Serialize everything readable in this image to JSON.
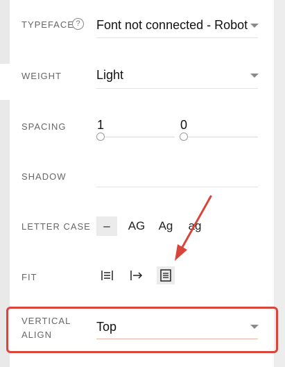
{
  "typeface": {
    "label": "TYPEFACE",
    "help_glyph": "?",
    "value": "Font not connected - Roboto"
  },
  "weight": {
    "label": "WEIGHT",
    "value": "Light"
  },
  "spacing": {
    "label": "SPACING",
    "letter_value": "1",
    "line_value": "0"
  },
  "shadow": {
    "label": "SHADOW"
  },
  "letter_case": {
    "label": "LETTER CASE",
    "options": [
      "–",
      "AG",
      "Ag",
      "ag"
    ],
    "selected": "–"
  },
  "fit": {
    "label": "FIT",
    "icons": [
      "align-justify-icon",
      "arrow-right-bar-icon",
      "text-block-icon"
    ],
    "selected": "text-block-icon"
  },
  "vertical_align": {
    "label_line1": "VERTICAL",
    "label_line2": "ALIGN",
    "value": "Top"
  },
  "colors": {
    "annotation_red": "#d8453b",
    "focused_underline": "#e8b3a8"
  }
}
